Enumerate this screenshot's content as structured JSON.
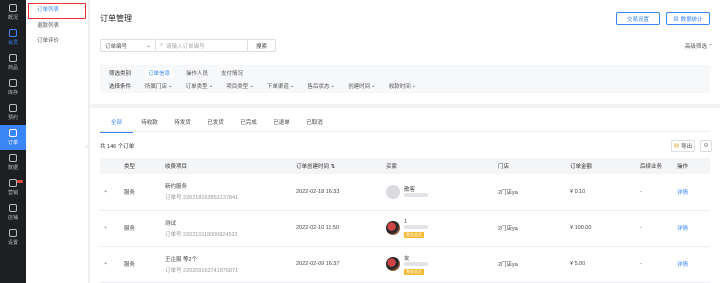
{
  "rail": [
    {
      "label": "概况",
      "icon": "home-icon"
    },
    {
      "label": "会员",
      "icon": "member-icon",
      "active": true
    },
    {
      "label": "商品",
      "icon": "goods-icon"
    },
    {
      "label": "库存",
      "icon": "inventory-icon"
    },
    {
      "label": "预约",
      "icon": "calendar-icon"
    },
    {
      "label": "订单",
      "icon": "order-icon",
      "selected": true
    },
    {
      "label": "数据",
      "icon": "data-icon"
    },
    {
      "label": "营销",
      "icon": "marketing-icon",
      "badge": true
    },
    {
      "label": "店铺",
      "icon": "store-icon"
    },
    {
      "label": "设置",
      "icon": "settings-icon"
    }
  ],
  "sub_menu": [
    "订单列表",
    "退款列表",
    "订单评价"
  ],
  "page_title": "订单管理",
  "header_buttons": {
    "transaction_settings": "交易设置",
    "data_stats": "数据统计"
  },
  "search": {
    "select_value": "订单编号",
    "placeholder": "请输入订单编号",
    "button": "搜索"
  },
  "advanced_filter": "高级筛选",
  "filter": {
    "type_label": "筛选类别",
    "type_tabs": [
      "订单信息",
      "操作人员",
      "支付情况"
    ],
    "cond_label": "选择条件",
    "conditions": [
      "所属门店",
      "订单类型",
      "项目类型",
      "下单渠道",
      "售后状态",
      "创建时间",
      "收款时间"
    ]
  },
  "tabs": [
    "全部",
    "待收款",
    "待发货",
    "已发货",
    "已完成",
    "已退单",
    "已取消"
  ],
  "count_text": "共 146 个订单",
  "export_label": "导出",
  "table": {
    "headers": [
      "",
      "类型",
      "收费项目",
      "订单创建时间",
      "买家",
      "门店",
      "订单金额",
      "后续业务",
      "操作"
    ],
    "rows": [
      {
        "type": "服务",
        "item": "新约服务",
        "order_no": "订单号 220218163853137841",
        "time": "2022-02-18 16:33",
        "buyer": "散客",
        "avatar_img": false,
        "badge": "",
        "store": "2门店ya",
        "amount": "¥ 0.10",
        "follow": "-",
        "action": "详情"
      },
      {
        "type": "服务",
        "item": "测试",
        "order_no": "订单号 220210115000824532",
        "time": "2022-02-10 11:50",
        "buyer": "1",
        "avatar_img": true,
        "badge": "黄金会员",
        "store": "2门店ya",
        "amount": "¥ 100.00",
        "follow": "-",
        "action": "详情"
      },
      {
        "type": "服务",
        "item": "王企服 等2个",
        "order_no": "订单号 220209163741876871",
        "time": "2022-02-09 16:37",
        "buyer": "友",
        "avatar_img": true,
        "badge": "黄金会员",
        "store": "2门店ya",
        "amount": "¥ 5.00",
        "follow": "-",
        "action": "详情"
      }
    ]
  },
  "colors": {
    "accent": "#3b86f7",
    "rail_bg": "#1d1f23"
  }
}
